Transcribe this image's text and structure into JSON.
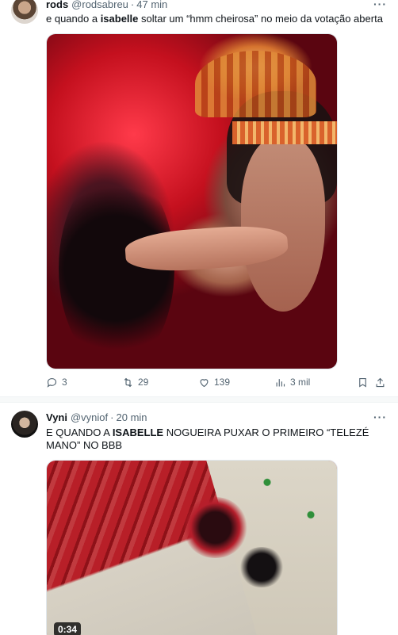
{
  "tweets": [
    {
      "author_name": "rods",
      "handle": "@rodsabreu",
      "separator": "·",
      "time": "47 min",
      "more": "···",
      "text_before": "e quando a ",
      "text_bold": "isabelle",
      "text_after": " soltar um “hmm cheirosa” no meio da votação aberta",
      "actions": {
        "reply_count": "3",
        "retweet_count": "29",
        "like_count": "139",
        "view_count": "3 mil"
      }
    },
    {
      "author_name": "Vyni",
      "handle": "@vyniof",
      "separator": "·",
      "time": "20 min",
      "more": "···",
      "text_before": "E QUANDO A ",
      "text_bold": "ISABELLE",
      "text_after": " NOGUEIRA PUXAR O PRIMEIRO “TELEZÉ MANO” NO BBB",
      "video_duration": "0:34"
    }
  ],
  "icons": {
    "reply": "speech-bubble-icon",
    "retweet": "retweet-arrows-icon",
    "like": "heart-icon",
    "views": "bar-chart-icon",
    "bookmark": "bookmark-icon",
    "share": "share-upload-icon"
  }
}
